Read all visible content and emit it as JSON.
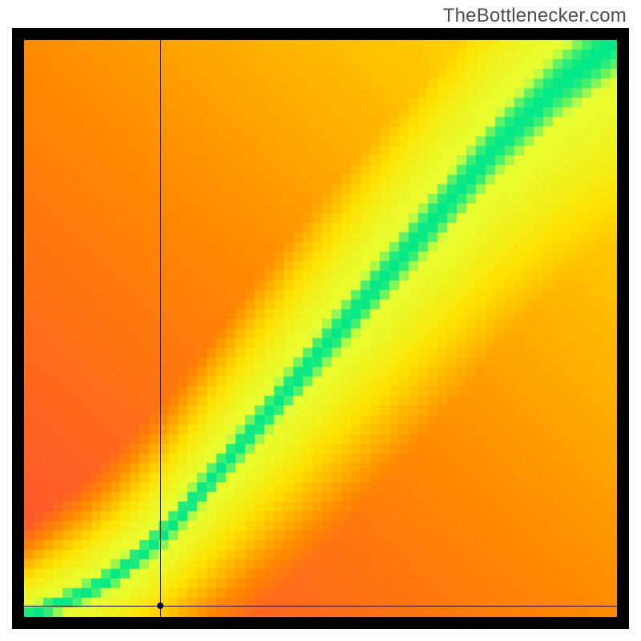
{
  "watermark": "TheBottlenecker.com",
  "chart_data": {
    "type": "heatmap",
    "title": "",
    "xlabel": "",
    "ylabel": "",
    "xlim": [
      0,
      100
    ],
    "ylim": [
      0,
      100
    ],
    "crosshair": {
      "x": 23,
      "y": 2
    },
    "optimal_curve": {
      "description": "Green band — optimal pairing ridge (approximate y values for given x, read from plot)",
      "x": [
        0,
        5,
        10,
        15,
        20,
        25,
        30,
        35,
        40,
        45,
        50,
        55,
        60,
        65,
        70,
        75,
        80,
        85,
        90,
        95,
        100
      ],
      "y": [
        0,
        2,
        4,
        7,
        11,
        16,
        22,
        28,
        34,
        40,
        46,
        52,
        58,
        64,
        70,
        76,
        82,
        87,
        92,
        96,
        100
      ]
    },
    "colorscale": [
      {
        "value": 0.0,
        "color": "#ff2357"
      },
      {
        "value": 0.45,
        "color": "#ff8a00"
      },
      {
        "value": 0.7,
        "color": "#ffe000"
      },
      {
        "value": 0.88,
        "color": "#e6ff33"
      },
      {
        "value": 1.0,
        "color": "#00e888"
      }
    ],
    "pixelation": 12
  }
}
